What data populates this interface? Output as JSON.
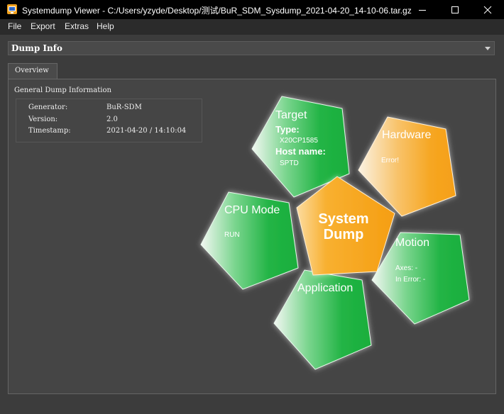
{
  "window": {
    "title": "Systemdump Viewer - C:/Users/yzyde/Desktop/测试/BuR_SDM_Sysdump_2021-04-20_14-10-06.tar.gz"
  },
  "menu": {
    "file": "File",
    "export": "Export",
    "extras": "Extras",
    "help": "Help"
  },
  "dump_selector": {
    "value": "Dump Info"
  },
  "tabs": {
    "overview": "Overview"
  },
  "general": {
    "title": "General Dump Information",
    "rows": [
      {
        "key": "Generator:",
        "value": "BuR-SDM"
      },
      {
        "key": "Version:",
        "value": "2.0"
      },
      {
        "key": "Timestamp:",
        "value": "2021-04-20 / 14:10:04"
      }
    ]
  },
  "diagram": {
    "center": {
      "line1": "System",
      "line2": "Dump"
    },
    "target": {
      "title": "Target",
      "type_label": "Type:",
      "type_value": "X20CP1585",
      "host_label": "Host name:",
      "host_value": "SPTD"
    },
    "hardware": {
      "title": "Hardware",
      "status": "Error!"
    },
    "cpu_mode": {
      "title": "CPU Mode",
      "value": "RUN"
    },
    "motion": {
      "title": "Motion",
      "axes": "Axes: -",
      "in_error": "In Error: -"
    },
    "application": {
      "title": "Application"
    }
  },
  "colors": {
    "green": "#1db73f",
    "orange": "#f7a21b",
    "background": "#3c3c3c"
  },
  "icons": {
    "app": "app-icon",
    "minimize": "minimize-icon",
    "maximize": "maximize-icon",
    "close": "close-icon",
    "dropdown": "chevron-down-icon"
  }
}
